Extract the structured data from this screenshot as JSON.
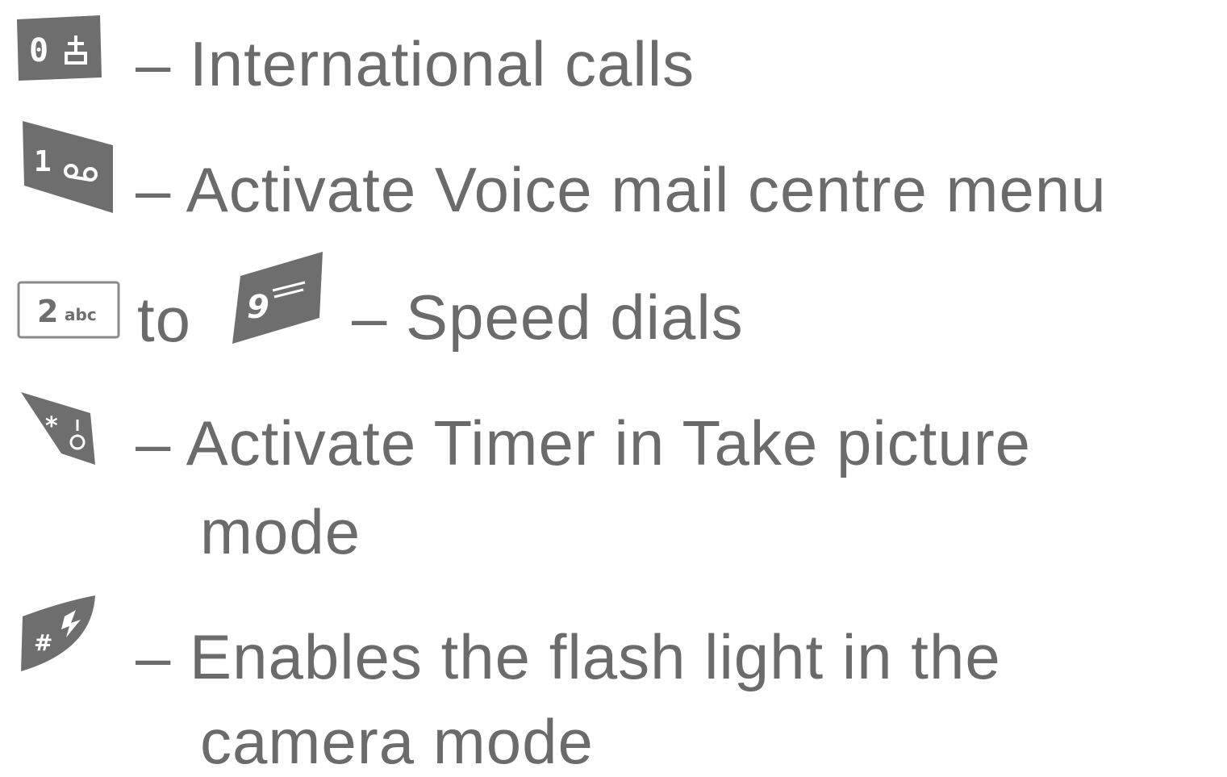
{
  "colors": {
    "text": "#6b6b6b",
    "key_fill": "#6e6e6e",
    "key_outline": "#6e6e6e",
    "key_glyph": "#ffffff"
  },
  "items": [
    {
      "key_icon": "key-0-international-icon",
      "key_glyph": "0",
      "text": "– International calls"
    },
    {
      "key_icon": "key-1-voicemail-icon",
      "key_glyph": "1",
      "text": "– Activate Voice mail centre menu"
    },
    {
      "key_icon": "key-2-abc-icon",
      "key_glyph": "2",
      "key_glyph_sub": "abc",
      "connector": "to",
      "key2_icon": "key-9-wxyz-icon",
      "key2_glyph": "9",
      "text": "– Speed dials"
    },
    {
      "key_icon": "key-star-timer-icon",
      "key_glyph": "*",
      "text_line1": "– Activate Timer in Take picture",
      "text_line2": "mode"
    },
    {
      "key_icon": "key-hash-flash-icon",
      "key_glyph": "#",
      "text_line1": "– Enables the flash light in the",
      "text_line2": "camera mode"
    }
  ]
}
